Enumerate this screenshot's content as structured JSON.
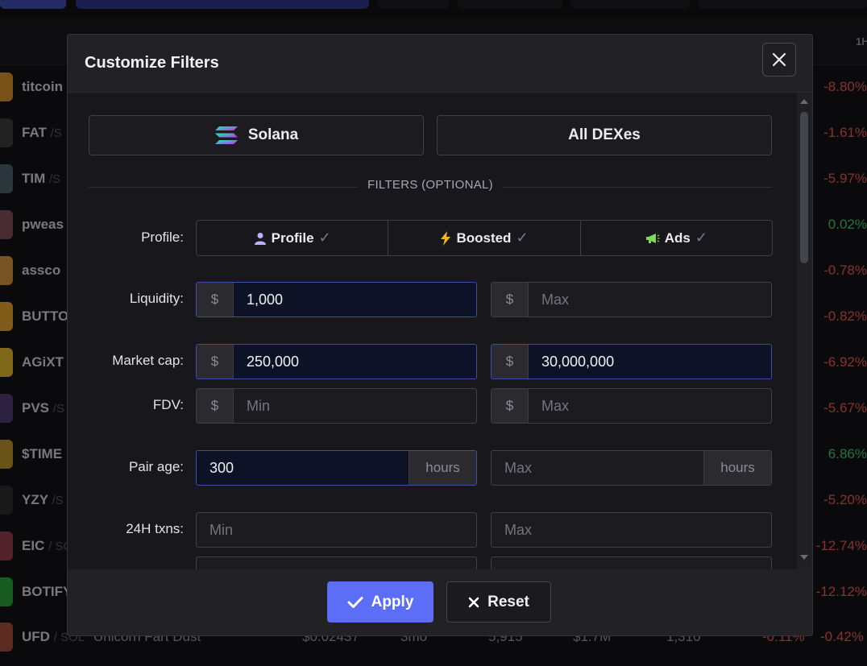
{
  "modal": {
    "title": "Customize Filters",
    "chain_label": "Solana",
    "dex_label": "All DEXes",
    "filters_heading": "FILTERS (OPTIONAL)",
    "profile_label": "Profile:",
    "toggles": [
      {
        "label": "Profile",
        "icon": "user-icon",
        "checked": false
      },
      {
        "label": "Boosted",
        "icon": "lightning-icon",
        "checked": false
      },
      {
        "label": "Ads",
        "icon": "megaphone-icon",
        "checked": false
      }
    ],
    "check_glyph": "✓",
    "currency_prefix": "$",
    "hours_suffix": "hours",
    "liquidity": {
      "label": "Liquidity:",
      "min_value": "1,000",
      "max_placeholder": "Max"
    },
    "market_cap": {
      "label": "Market cap:",
      "min_value": "250,000",
      "max_value": "30,000,000"
    },
    "fdv": {
      "label": "FDV:",
      "min_placeholder": "Min",
      "max_placeholder": "Max"
    },
    "pair_age": {
      "label": "Pair age:",
      "min_value": "300",
      "max_placeholder": "Max"
    },
    "txns_24h": {
      "label": "24H txns:",
      "min_placeholder": "Min",
      "max_placeholder": "Max"
    },
    "apply_label": "Apply",
    "reset_label": "Reset"
  },
  "background": {
    "header_col": "1H",
    "rows": [
      {
        "ticker": "titcoin",
        "quote": "",
        "change": "-8.80%",
        "trend": "neg",
        "color": "#c9882a"
      },
      {
        "ticker": "FAT",
        "quote": "/S",
        "change": "-1.61%",
        "trend": "neg",
        "color": "#3a3a3a"
      },
      {
        "ticker": "TIM",
        "quote": "/S",
        "change": "-5.97%",
        "trend": "neg",
        "color": "#4a5a66"
      },
      {
        "ticker": "pweas",
        "quote": "",
        "change": "0.02%",
        "trend": "pos",
        "color": "#7a4a52"
      },
      {
        "ticker": "assco",
        "quote": "",
        "change": "-0.78%",
        "trend": "neg",
        "color": "#c98a3a"
      },
      {
        "ticker": "BUTTO",
        "quote": "",
        "change": "-0.82%",
        "trend": "neg",
        "color": "#d49a2a"
      },
      {
        "ticker": "AGiXT",
        "quote": "",
        "change": "-6.92%",
        "trend": "neg",
        "color": "#d4b02a"
      },
      {
        "ticker": "PVS",
        "quote": "/S",
        "change": "-5.67%",
        "trend": "neg",
        "color": "#4a3a6a"
      },
      {
        "ticker": "$TIME",
        "quote": "",
        "change": "6.86%",
        "trend": "pos",
        "color": "#b08a2a"
      },
      {
        "ticker": "YZY",
        "quote": "/S",
        "change": "-5.20%",
        "trend": "neg",
        "color": "#2a2a2a"
      },
      {
        "ticker": "EIC",
        "quote": "/ SC",
        "change": "-12.74%",
        "trend": "neg",
        "color": "#8a3a4a"
      },
      {
        "ticker": "BOTIFY",
        "quote": "",
        "change": "-12.12%",
        "trend": "neg",
        "color": "#2a9a3a"
      }
    ],
    "last_row": {
      "ticker": "UFD",
      "quote": "/ SOL",
      "name": "Unicorn Fart Dust",
      "price": "$0.02437",
      "age": "3mo",
      "txns": "5,915",
      "volume": "$1.7M",
      "makers": "1,310",
      "change_5m": "-0.11%",
      "change_1h": "-0.42%"
    }
  }
}
